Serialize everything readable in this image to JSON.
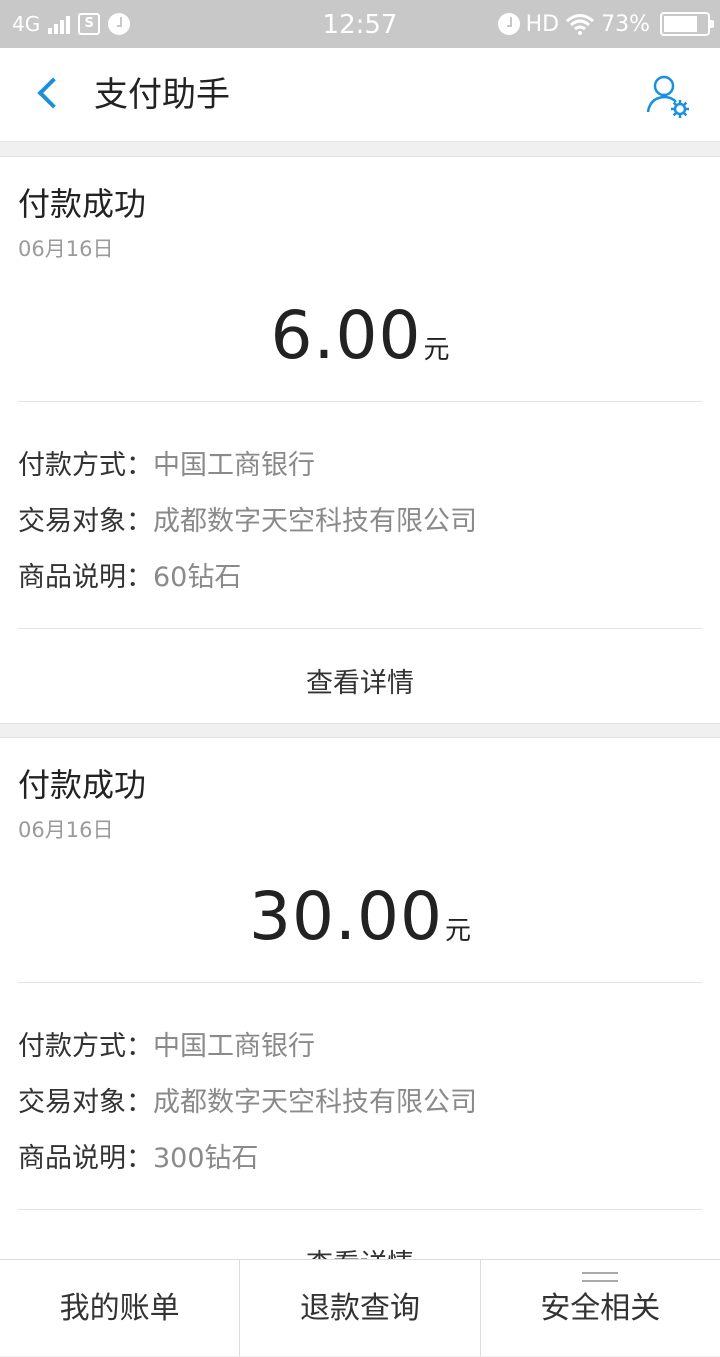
{
  "status_bar": {
    "network": "4G",
    "time": "12:57",
    "hd": "HD",
    "battery": "73%"
  },
  "header": {
    "title": "支付助手"
  },
  "cards": [
    {
      "title": "付款成功",
      "date": "06月16日",
      "amount": "6.00",
      "unit": "元",
      "pay_method_label": "付款方式：",
      "pay_method": "中国工商银行",
      "counterparty_label": "交易对象：",
      "counterparty": "成都数字天空科技有限公司",
      "item_label": "商品说明：",
      "item": "60钻石",
      "detail_link": "查看详情"
    },
    {
      "title": "付款成功",
      "date": "06月16日",
      "amount": "30.00",
      "unit": "元",
      "pay_method_label": "付款方式：",
      "pay_method": "中国工商银行",
      "counterparty_label": "交易对象：",
      "counterparty": "成都数字天空科技有限公司",
      "item_label": "商品说明：",
      "item": "300钻石",
      "detail_link": "查看详情"
    }
  ],
  "tabbar": {
    "items": [
      "我的账单",
      "退款查询",
      "安全相关"
    ]
  },
  "colors": {
    "accent": "#1a8fe0",
    "status_bar": "#c8c8c8"
  },
  "icons": {
    "back": "chevron-left-icon",
    "settings": "user-settings-icon",
    "menu": "menu-handle-icon"
  }
}
